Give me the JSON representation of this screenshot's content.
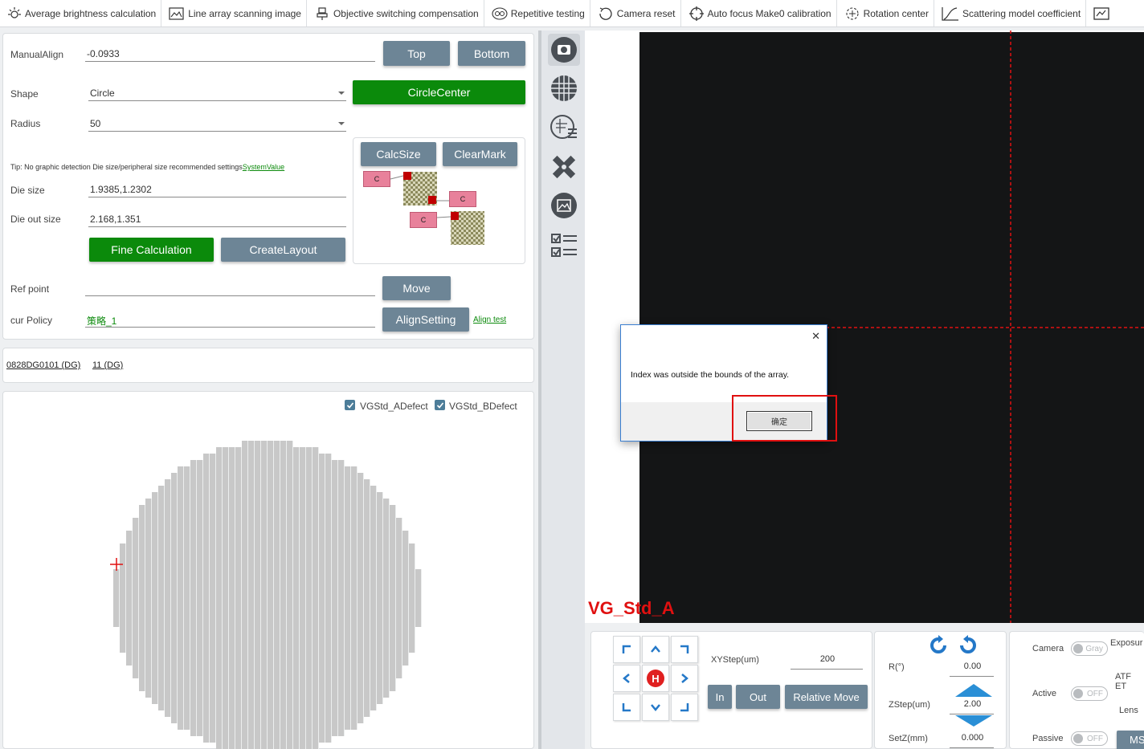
{
  "toolbar": {
    "items": [
      {
        "label": "Average brightness calculation",
        "icon": "brightness-icon"
      },
      {
        "label": "Line array scanning image",
        "icon": "scan-image-icon"
      },
      {
        "label": "Objective switching compensation",
        "icon": "objective-icon"
      },
      {
        "label": "Repetitive testing",
        "icon": "repeat-icon"
      },
      {
        "label": "Camera reset",
        "icon": "reset-icon"
      },
      {
        "label": "Auto focus Make0 calibration",
        "icon": "crosshair-icon"
      },
      {
        "label": "Rotation center",
        "icon": "rotation-center-icon"
      },
      {
        "label": "Scattering model coefficient",
        "icon": "curve-icon"
      }
    ]
  },
  "align": {
    "manual_align_label": "ManualAlign",
    "manual_align_value": "-0.0933",
    "top_label": "Top",
    "bottom_label": "Bottom",
    "shape_label": "Shape",
    "shape_value": "Circle",
    "circle_center_label": "CircleCenter",
    "radius_label": "Radius",
    "radius_value": "50",
    "calc_size_label": "CalcSize",
    "clear_mark_label": "ClearMark",
    "mark_c": "C",
    "tip_text": "Tip: No graphic detection Die size/peripheral size recommended settings",
    "tip_link": "SystemValue",
    "die_size_label": "Die size",
    "die_size_value": "1.9385,1.2302",
    "die_out_label": "Die out size",
    "die_out_value": "2.168,1.351",
    "fine_calc_label": "Fine Calculation",
    "create_layout_label": "CreateLayout",
    "ref_point_label": "Ref point",
    "ref_point_value": "",
    "move_label": "Move",
    "cur_policy_label": "cur Policy",
    "cur_policy_value": "策略_1",
    "align_setting_label": "AlignSetting",
    "align_test_label": "Align test"
  },
  "recipe": {
    "link1": "0828DG0101 (DG)",
    "link2": "11 (DG)"
  },
  "wafer": {
    "chk_a": "VGStd_ADefect",
    "chk_b": "VGStd_BDefect"
  },
  "viewer": {
    "overlay_label": "VG_Std_A"
  },
  "dialog": {
    "message": "Index was outside the bounds of the array.",
    "ok_label": "确定",
    "close": "✕"
  },
  "controls": {
    "home_label": "H",
    "xystep_label": "XYStep(um)",
    "xystep_value": "200",
    "in_label": "In",
    "out_label": "Out",
    "relative_move_label": "Relative Move",
    "r_label": "R(°)",
    "r_value": "0.00",
    "zstep_label": "ZStep(um)",
    "zstep_value": "2.00",
    "setz_label": "SetZ(mm)",
    "setz_value": "0.000",
    "camera_label": "Camera",
    "camera_toggle": "Gray",
    "active_label": "Active",
    "active_toggle": "OFF",
    "passive_label": "Passive",
    "passive_toggle": "OFF",
    "exposure_label": "Exposur",
    "atf_label": "ATF ET",
    "lens_label": "Lens",
    "ms_label": "MS"
  },
  "colors": {
    "accent_gray_button": "#6d8596",
    "green_button": "#0b8a0b",
    "mark_pink": "#e8819b",
    "overlay_red": "#e01010",
    "jog_blue": "#2478c8"
  }
}
